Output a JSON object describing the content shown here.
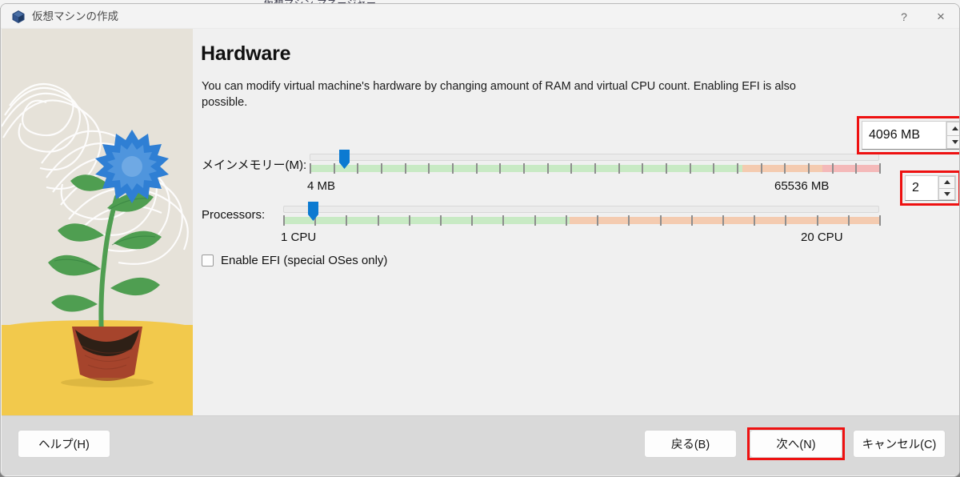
{
  "background_window": {
    "title_fragment": "仮想マシン マネージャー"
  },
  "titlebar": {
    "title": "仮想マシンの作成",
    "icon": "virtualbox-cube-icon",
    "help_label": "?",
    "close_label": "×"
  },
  "page": {
    "heading": "Hardware",
    "description": "You can modify virtual machine's hardware by changing amount of RAM and virtual CPU count. Enabling EFI is also possible."
  },
  "memory": {
    "label": "メインメモリー(M):",
    "min_label": "4 MB",
    "max_label": "65536 MB",
    "value": "4096 MB",
    "handle_percent": 6,
    "green_end_percent": 76,
    "orange_end_percent": 90,
    "zone_green": "#c8eac4",
    "zone_orange": "#f4cbb0",
    "zone_red": "#f4b9b9"
  },
  "processors": {
    "label": "Processors:",
    "min_label": "1 CPU",
    "max_label": "20 CPU",
    "value": "2",
    "handle_percent": 5,
    "green_end_percent": 48,
    "orange_end_percent": 100,
    "zone_green": "#c8eac4",
    "zone_orange": "#f4cbb0",
    "zone_red": "#f4b9b9"
  },
  "efi": {
    "label": "Enable EFI (special OSes only)",
    "checked": false
  },
  "footer": {
    "help": "ヘルプ(H)",
    "back": "戻る(B)",
    "next": "次へ(N)",
    "cancel": "キャンセル(C)"
  },
  "annotations": {
    "color": "#ee1111",
    "targets": [
      "memory-spinbox",
      "processors-spinbox",
      "next-button"
    ]
  },
  "illustration": {
    "alt": "potted-cornflower-plant-illustration",
    "background": "#e6e2d9",
    "ground": "#f2c94c",
    "flower": "#2f7fd4",
    "leaf": "#4f9e51",
    "pot": "#a6442c"
  }
}
